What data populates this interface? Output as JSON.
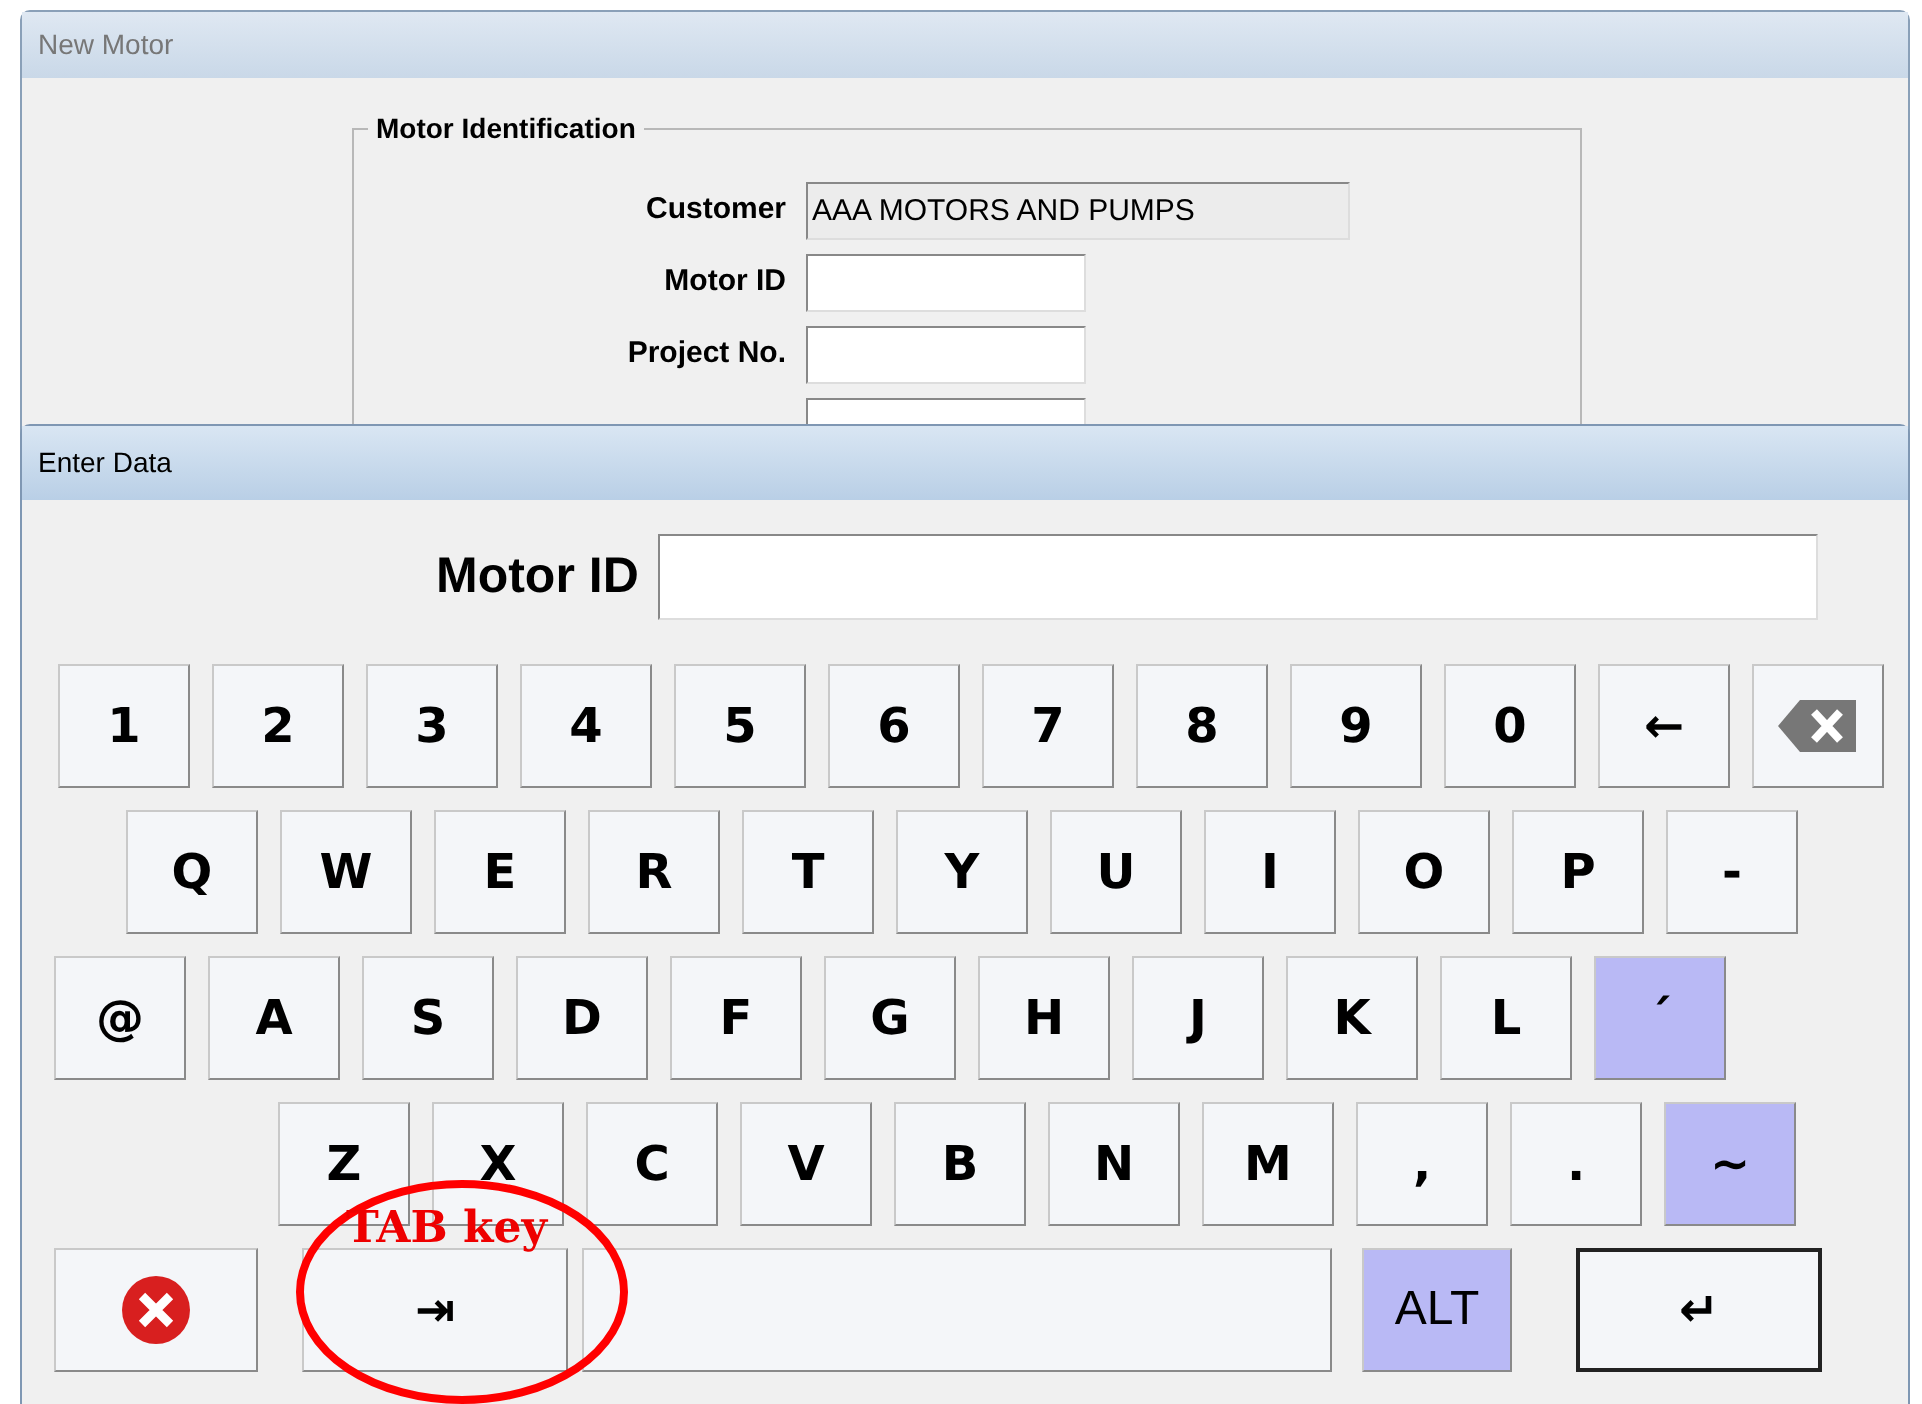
{
  "back_window": {
    "title": "New Motor",
    "group_title": "Motor Identification",
    "fields": [
      {
        "label": "Customer",
        "value": "AAA MOTORS AND PUMPS",
        "disabled": true
      },
      {
        "label": "Motor ID",
        "disabled": false
      },
      {
        "label": "Project No.",
        "disabled": false
      },
      {
        "disabled": false
      }
    ]
  },
  "dialog": {
    "title": "Enter Data",
    "field_label": "Motor ID"
  },
  "keyboard": [
    {
      "keys": [
        {
          "kind": "char",
          "label": "1",
          "highlighted": false
        },
        {
          "kind": "char",
          "label": "2",
          "highlighted": false
        },
        {
          "kind": "char",
          "label": "3",
          "highlighted": false
        },
        {
          "kind": "char",
          "label": "4",
          "highlighted": false
        },
        {
          "kind": "char",
          "label": "5",
          "highlighted": false
        },
        {
          "kind": "char",
          "label": "6",
          "highlighted": false
        },
        {
          "kind": "char",
          "label": "7",
          "highlighted": false
        },
        {
          "kind": "char",
          "label": "8",
          "highlighted": false
        },
        {
          "kind": "char",
          "label": "9",
          "highlighted": false
        },
        {
          "kind": "char",
          "label": "0",
          "highlighted": false
        },
        {
          "kind": "char",
          "label": "←",
          "highlighted": false
        },
        {
          "kind": "backspace",
          "highlighted": false
        }
      ]
    },
    {
      "keys": [
        {
          "kind": "char",
          "label": "Q",
          "highlighted": false
        },
        {
          "kind": "char",
          "label": "W",
          "highlighted": false
        },
        {
          "kind": "char",
          "label": "E",
          "highlighted": false
        },
        {
          "kind": "char",
          "label": "R",
          "highlighted": false
        },
        {
          "kind": "char",
          "label": "T",
          "highlighted": false
        },
        {
          "kind": "char",
          "label": "Y",
          "highlighted": false
        },
        {
          "kind": "char",
          "label": "U",
          "highlighted": false
        },
        {
          "kind": "char",
          "label": "I",
          "highlighted": false
        },
        {
          "kind": "char",
          "label": "O",
          "highlighted": false
        },
        {
          "kind": "char",
          "label": "P",
          "highlighted": false
        },
        {
          "kind": "char",
          "label": "-",
          "highlighted": false
        }
      ]
    },
    {
      "keys": [
        {
          "kind": "char",
          "label": "@",
          "highlighted": false
        },
        {
          "kind": "char",
          "label": "A",
          "highlighted": false
        },
        {
          "kind": "char",
          "label": "S",
          "highlighted": false
        },
        {
          "kind": "char",
          "label": "D",
          "highlighted": false
        },
        {
          "kind": "char",
          "label": "F",
          "highlighted": false
        },
        {
          "kind": "char",
          "label": "G",
          "highlighted": false
        },
        {
          "kind": "char",
          "label": "H",
          "highlighted": false
        },
        {
          "kind": "char",
          "label": "J",
          "highlighted": false
        },
        {
          "kind": "char",
          "label": "K",
          "highlighted": false
        },
        {
          "kind": "char",
          "label": "L",
          "highlighted": false
        },
        {
          "kind": "char",
          "label": "´",
          "highlighted": true
        }
      ]
    },
    {
      "keys": [
        {
          "kind": "char",
          "label": "Z",
          "highlighted": false
        },
        {
          "kind": "char",
          "label": "X",
          "highlighted": false
        },
        {
          "kind": "char",
          "label": "C",
          "highlighted": false
        },
        {
          "kind": "char",
          "label": "V",
          "highlighted": false
        },
        {
          "kind": "char",
          "label": "B",
          "highlighted": false
        },
        {
          "kind": "char",
          "label": "N",
          "highlighted": false
        },
        {
          "kind": "char",
          "label": "M",
          "highlighted": false
        },
        {
          "kind": "char",
          "label": ",",
          "highlighted": false
        },
        {
          "kind": "char",
          "label": ".",
          "highlighted": false
        },
        {
          "kind": "char",
          "label": "~",
          "highlighted": true
        }
      ]
    },
    {
      "keys": [
        {
          "kind": "cancel",
          "highlighted": false
        },
        {
          "kind": "tab",
          "label": "⇥",
          "highlighted": false
        },
        {
          "kind": "space",
          "highlighted": false
        },
        {
          "kind": "alt",
          "label": "ALT",
          "highlighted": true
        },
        {
          "kind": "enter",
          "label": "↵",
          "highlighted": false
        }
      ]
    }
  ],
  "annotation": {
    "label": "TAB key"
  }
}
